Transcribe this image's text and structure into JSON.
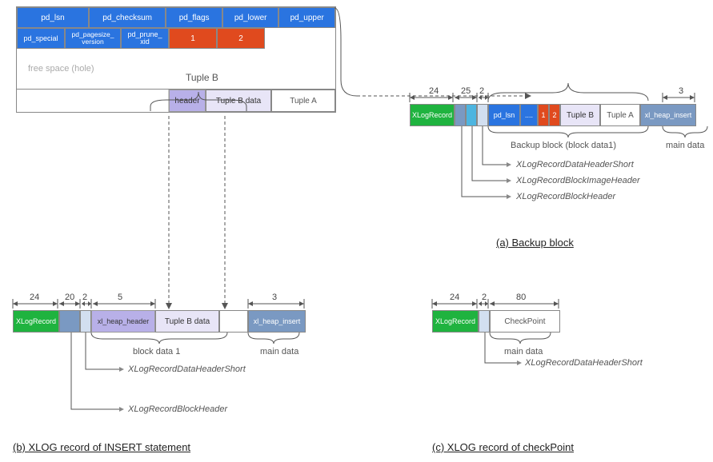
{
  "page_header": {
    "row1": [
      "pd_lsn",
      "pd_checksum",
      "pd_flags",
      "pd_lower",
      "pd_upper"
    ],
    "row2_labels": [
      "pd_special",
      "pd_pagesize_\nversion",
      "pd_prune_\nxid"
    ],
    "row2_nums": [
      "1",
      "2"
    ],
    "free_space": "free space (hole)",
    "tuple_b_label": "Tuple B",
    "tuple_row": {
      "header": "header",
      "tuple_b_data": "Tuple B data",
      "tuple_a": "Tuple A"
    }
  },
  "section_a": {
    "caption": "(a) Backup block",
    "dims": {
      "d24": "24",
      "d25": "25",
      "d2": "2",
      "d3": "3"
    },
    "cells": {
      "xlog": "XLogRecord",
      "pd_lsn": "pd_lsn",
      "dots": "....",
      "n1": "1",
      "n2": "2",
      "tuple_b": "Tuple B",
      "tuple_a": "Tuple A",
      "xl_heap_insert": "xl_heap_insert"
    },
    "backup_block_label": "Backup block (block data1)",
    "main_data": "main data",
    "callouts": {
      "dh": "XLogRecordDataHeaderShort",
      "bih": "XLogRecordBlockImageHeader",
      "bh": "XLogRecordBlockHeader"
    }
  },
  "section_b": {
    "caption": "(b) XLOG record of INSERT statement",
    "dims": {
      "d24": "24",
      "d20": "20",
      "d2": "2",
      "d5": "5",
      "d3": "3"
    },
    "cells": {
      "xlog": "XLogRecord",
      "xl_heap_header": "xl_heap_header",
      "tuple_b_data": "Tuple B data",
      "xl_heap_insert": "xl_heap_insert"
    },
    "block_data_label": "block data 1",
    "main_data": "main data",
    "callouts": {
      "dh": "XLogRecordDataHeaderShort",
      "bh": "XLogRecordBlockHeader"
    }
  },
  "section_c": {
    "caption": "(c) XLOG record of checkPoint",
    "dims": {
      "d24": "24",
      "d2": "2",
      "d80": "80"
    },
    "cells": {
      "xlog": "XLogRecord",
      "cp": "CheckPoint"
    },
    "main_data": "main data",
    "callouts": {
      "dh": "XLogRecordDataHeaderShort"
    }
  }
}
